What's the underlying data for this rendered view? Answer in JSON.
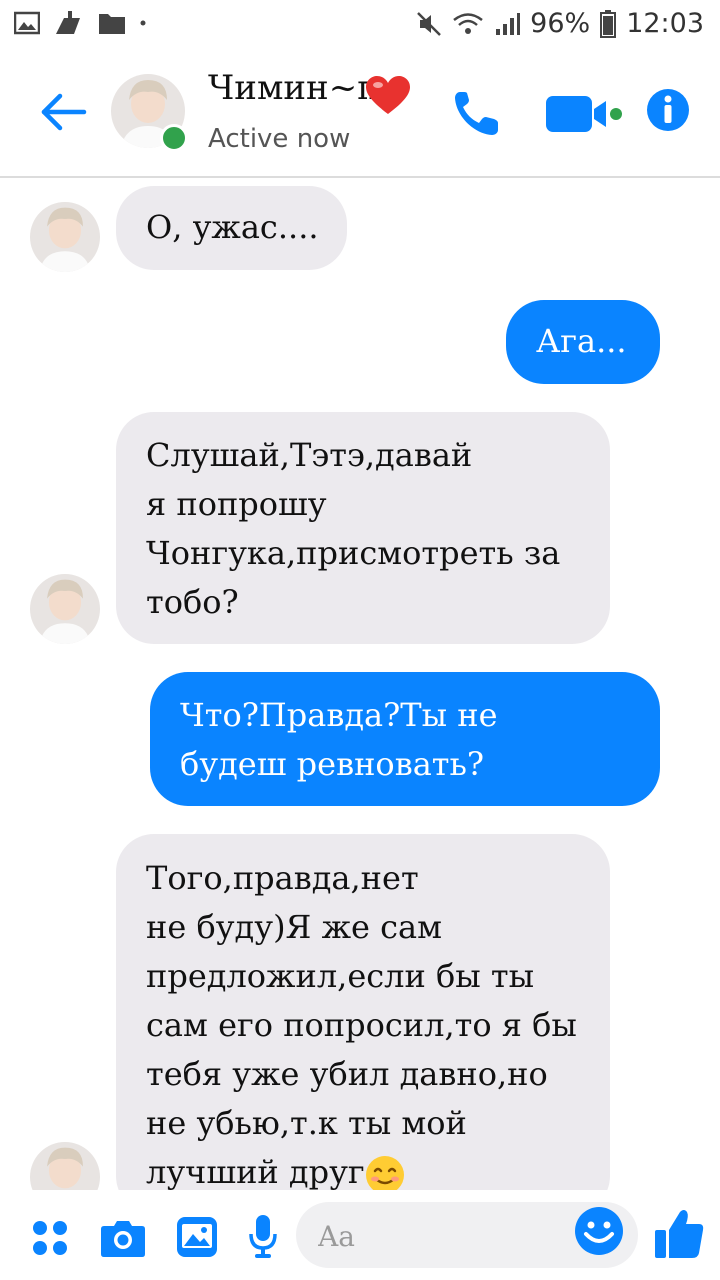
{
  "statusbar": {
    "battery": "96%",
    "time": "12:03"
  },
  "header": {
    "contact_name": "Чимин~п",
    "status": "Active now"
  },
  "messages": [
    {
      "direction": "incoming",
      "text": "О, ужас...."
    },
    {
      "direction": "outgoing",
      "text": "Ага..."
    },
    {
      "direction": "incoming",
      "text": "Слушай,Тэтэ,давай\nя попрошу\nЧонгука,присмотреть за\nтобо?"
    },
    {
      "direction": "outgoing",
      "text": "Что?Правда?Ты не\nбудеш ревновать?"
    },
    {
      "direction": "incoming",
      "text": "Того,правда,нет\nне буду)Я же сам\nпредложил,если бы ты\nсам его попросил,то я бы\nтебя уже убил давно,но\nне убью,т.к ты мой\nлучший друг"
    }
  ],
  "composer": {
    "placeholder": "Aa"
  },
  "colors": {
    "accent": "#0a84ff",
    "incoming_bubble": "#eceaee",
    "online": "#31a24c"
  },
  "icons": {
    "header": [
      "back-arrow-icon",
      "phone-icon",
      "video-camera-icon",
      "info-icon"
    ],
    "composer": [
      "apps-grid-icon",
      "camera-icon",
      "gallery-icon",
      "microphone-icon",
      "emoji-icon",
      "thumbs-up-icon"
    ]
  }
}
